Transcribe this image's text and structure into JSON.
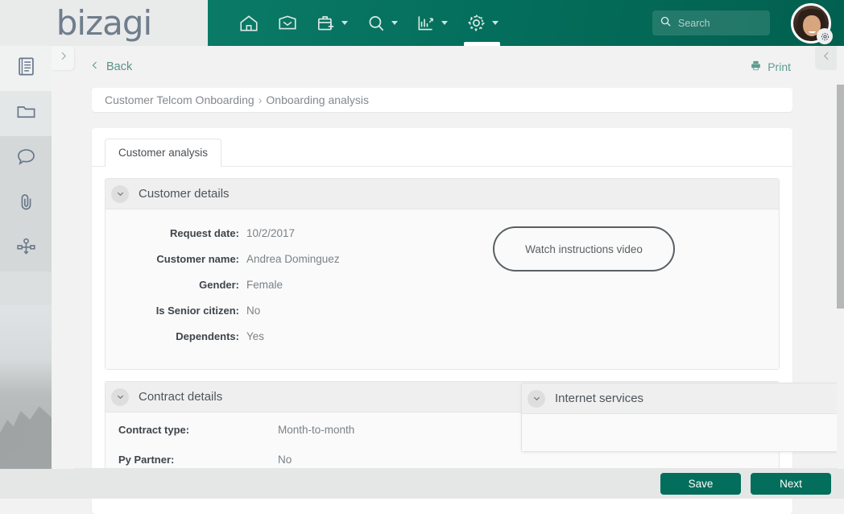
{
  "header": {
    "logo": "bizagi",
    "nav": [
      {
        "name": "home",
        "icon": "home-icon",
        "caret": false,
        "active": false
      },
      {
        "name": "inbox",
        "icon": "inbox-icon",
        "caret": false,
        "active": false
      },
      {
        "name": "new-case",
        "icon": "briefcase-plus-icon",
        "caret": true,
        "active": false
      },
      {
        "name": "search",
        "icon": "magnifier-icon",
        "caret": true,
        "active": false
      },
      {
        "name": "analytics",
        "icon": "chart-icon",
        "caret": true,
        "active": false
      },
      {
        "name": "settings",
        "icon": "gear-icon",
        "caret": true,
        "active": true
      }
    ],
    "search": {
      "value": "",
      "placeholder": "Search",
      "icon": "search-icon"
    },
    "avatar": {
      "name": "user-avatar",
      "badge_icon": "gear-icon"
    }
  },
  "rail": {
    "items": [
      {
        "icon": "form-list-icon",
        "label": "Form"
      },
      {
        "icon": "folder-icon",
        "label": "Documents"
      },
      {
        "icon": "comment-bubble-icon",
        "label": "Comments"
      },
      {
        "icon": "paperclip-icon",
        "label": "Attachments"
      },
      {
        "icon": "process-diagram-icon",
        "label": "Process"
      }
    ],
    "expand_tab_icon": "chevron-right-icon",
    "collapse_tab_icon": "chevron-left-icon"
  },
  "toolbar": {
    "back_label": "Back",
    "back_icon": "chevron-left-icon",
    "print_label": "Print",
    "print_icon": "printer-icon"
  },
  "breadcrumb": {
    "process": "Customer Telcom Onboarding",
    "separator": "›",
    "activity": "Onboarding analysis"
  },
  "tabs": [
    {
      "label": "Customer analysis",
      "active": true
    }
  ],
  "sections": [
    {
      "title": "Customer details",
      "chevron": "chevron-down-icon",
      "fields": [
        {
          "label": "Request date:",
          "value": "10/2/2017"
        },
        {
          "label": "Customer name:",
          "value": "Andrea Dominguez"
        },
        {
          "label": "Gender:",
          "value": "Female"
        },
        {
          "label": "Is Senior citizen:",
          "value": "No"
        },
        {
          "label": "Dependents:",
          "value": "Yes"
        }
      ]
    },
    {
      "title": "Contract details",
      "chevron": "chevron-down-icon",
      "fields": [
        {
          "label": "Contract type:",
          "value": "Month-to-month"
        },
        {
          "label": "Py Partner:",
          "value": "No"
        }
      ]
    }
  ],
  "video_button": {
    "label": "Watch instructions video"
  },
  "floating_panel": {
    "title": "Internet services",
    "chevron": "chevron-down-icon"
  },
  "footer": {
    "save_label": "Save",
    "next_label": "Next"
  },
  "colors": {
    "brand_teal": "#046e5c",
    "brand_teal_light": "#0a7a66",
    "link_teal": "#5b9187",
    "logo_gray": "#6f7d8c",
    "page_bg": "#f2f2f2"
  }
}
